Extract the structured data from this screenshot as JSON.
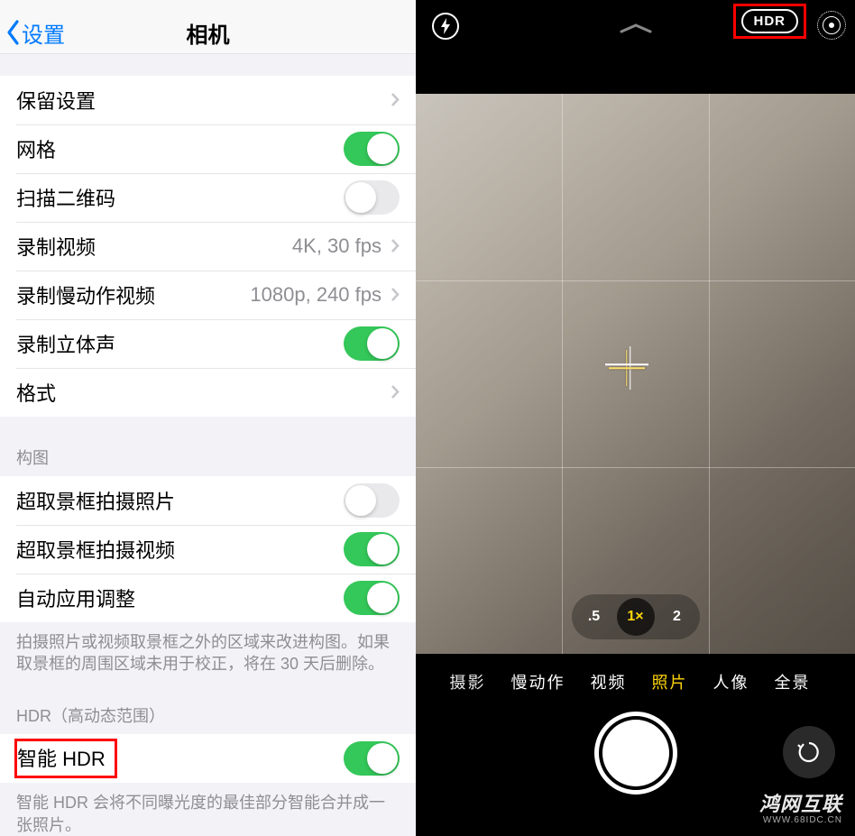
{
  "settings": {
    "back_label": "设置",
    "title": "相机",
    "rows": {
      "preserve": "保留设置",
      "grid": "网格",
      "qr": "扫描二维码",
      "video": {
        "label": "录制视频",
        "value": "4K, 30 fps"
      },
      "slomo": {
        "label": "录制慢动作视频",
        "value": "1080p, 240 fps"
      },
      "stereo": "录制立体声",
      "formats": "格式"
    },
    "composition": {
      "header": "构图",
      "over_photo": "超取景框拍摄照片",
      "over_video": "超取景框拍摄视频",
      "auto_adjust": "自动应用调整",
      "footer": "拍摄照片或视频取景框之外的区域来改进构图。如果取景框的周围区域未用于校正，将在 30 天后删除。"
    },
    "hdr": {
      "header": "HDR（高动态范围）",
      "smart": "智能 HDR",
      "footer": "智能 HDR 会将不同曝光度的最佳部分智能合并成一张照片。"
    }
  },
  "camera": {
    "hdr_label": "HDR",
    "zoom": {
      "wide": ".5",
      "normal": "1×",
      "tele": "2"
    },
    "modes": {
      "partial": "摄影",
      "slomo": "慢动作",
      "video": "视频",
      "photo": "照片",
      "portrait": "人像",
      "pano": "全景"
    }
  },
  "watermark": {
    "line1": "鸿网互联",
    "line2": "WWW.68IDC.CN"
  }
}
